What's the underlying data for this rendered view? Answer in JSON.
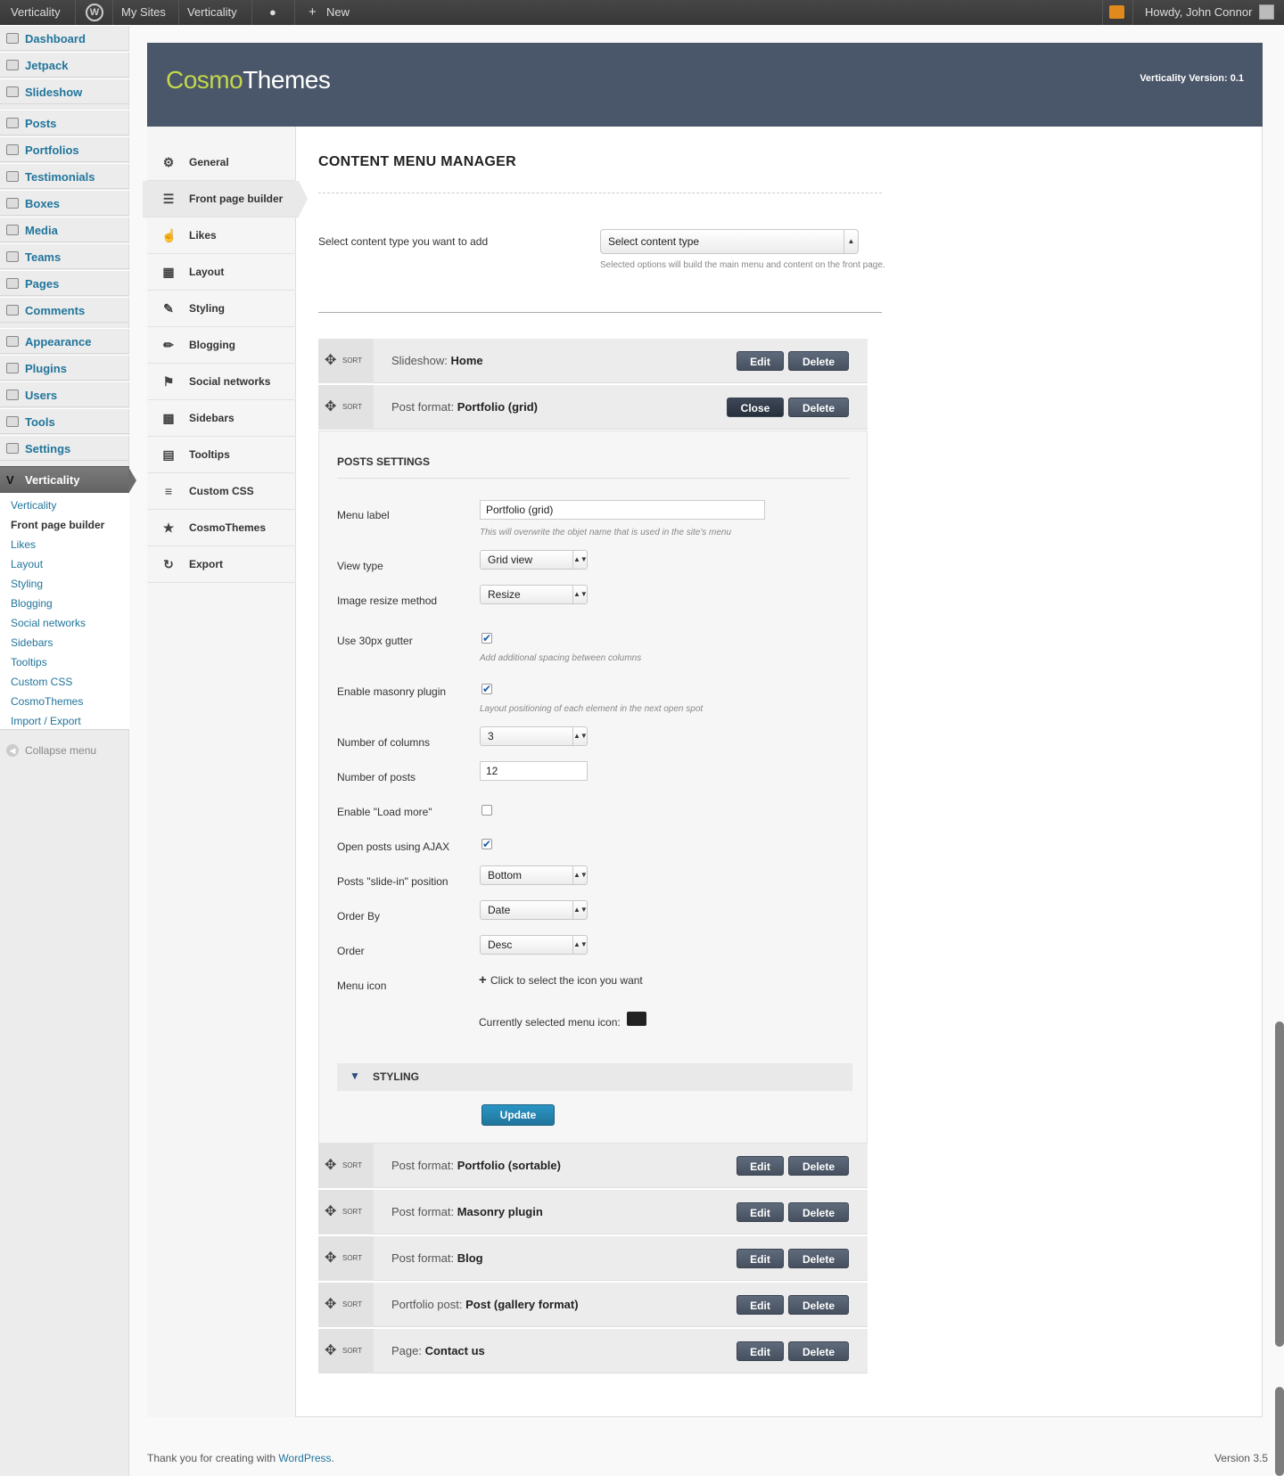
{
  "adminbar": {
    "site": "Verticality",
    "my_sites": "My Sites",
    "site2": "Verticality",
    "new": "New",
    "howdy": "Howdy, John Connor"
  },
  "menu": {
    "items": [
      {
        "label": "Dashboard",
        "icon": "dashboard-icon"
      },
      {
        "label": "Jetpack",
        "icon": "jetpack-icon"
      },
      {
        "label": "Slideshow",
        "icon": "slideshow-icon"
      },
      {
        "label": "Posts",
        "icon": "posts-icon"
      },
      {
        "label": "Portfolios",
        "icon": "portfolios-icon"
      },
      {
        "label": "Testimonials",
        "icon": "testimonials-icon"
      },
      {
        "label": "Boxes",
        "icon": "boxes-icon"
      },
      {
        "label": "Media",
        "icon": "media-icon"
      },
      {
        "label": "Teams",
        "icon": "teams-icon"
      },
      {
        "label": "Pages",
        "icon": "pages-icon"
      },
      {
        "label": "Comments",
        "icon": "comments-icon"
      },
      {
        "label": "Appearance",
        "icon": "appearance-icon"
      },
      {
        "label": "Plugins",
        "icon": "plugins-icon"
      },
      {
        "label": "Users",
        "icon": "users-icon"
      },
      {
        "label": "Tools",
        "icon": "tools-icon"
      },
      {
        "label": "Settings",
        "icon": "settings-icon"
      }
    ],
    "active": "Verticality",
    "submenu": [
      "Verticality",
      "Front page builder",
      "Likes",
      "Layout",
      "Styling",
      "Blogging",
      "Social networks",
      "Sidebars",
      "Tooltips",
      "Custom CSS",
      "CosmoThemes",
      "Import / Export"
    ],
    "collapse": "Collapse menu"
  },
  "header": {
    "logo_a": "Cosmo",
    "logo_b": "Themes",
    "version": "Verticality Version: 0.1"
  },
  "tabs": [
    "General",
    "Front page builder",
    "Likes",
    "Layout",
    "Styling",
    "Blogging",
    "Social networks",
    "Sidebars",
    "Tooltips",
    "Custom CSS",
    "CosmoThemes",
    "Export"
  ],
  "content": {
    "title": "CONTENT MENU MANAGER",
    "select_label": "Select content type you want to add",
    "select_value": "Select content type",
    "select_hint": "Selected options will build the main menu and content on the front page."
  },
  "rows": [
    {
      "prefix": "Slideshow: ",
      "name": "Home",
      "btn": "Edit"
    },
    {
      "prefix": "Post format: ",
      "name": "Portfolio (grid)",
      "btn": "Close"
    },
    {
      "prefix": "Post format: ",
      "name": "Portfolio (sortable)",
      "btn": "Edit"
    },
    {
      "prefix": "Post format: ",
      "name": "Masonry plugin",
      "btn": "Edit"
    },
    {
      "prefix": "Post format: ",
      "name": "Blog",
      "btn": "Edit"
    },
    {
      "prefix": "Portfolio post: ",
      "name": "Post (gallery format)",
      "btn": "Edit"
    },
    {
      "prefix": "Page: ",
      "name": "Contact us",
      "btn": "Edit"
    }
  ],
  "sort": "SORT",
  "delete": "Delete",
  "settings": {
    "title": "POSTS SETTINGS",
    "menu_label": "Menu label",
    "menu_label_value": "Portfolio (grid)",
    "menu_label_hint": "This will overwrite the objet name that is used in the site's menu",
    "view_type": "View type",
    "view_type_value": "Grid view",
    "resize": "Image resize method",
    "resize_value": "Resize",
    "gutter": "Use 30px gutter",
    "gutter_hint": "Add additional spacing between columns",
    "masonry": "Enable masonry plugin",
    "masonry_hint": "Layout positioning of each element in the next open spot",
    "columns": "Number of columns",
    "columns_value": "3",
    "posts": "Number of posts",
    "posts_value": "12",
    "loadmore": "Enable \"Load more\"",
    "ajax": "Open posts using AJAX",
    "slidein": "Posts \"slide-in\" position",
    "slidein_value": "Bottom",
    "orderby": "Order By",
    "orderby_value": "Date",
    "order": "Order",
    "order_value": "Desc",
    "menuicon": "Menu icon",
    "menuicon_link": "Click to select the icon you want",
    "current_icon": "Currently selected menu icon:",
    "styling": "STYLING",
    "update": "Update"
  },
  "footer": {
    "thanks": "Thank you for creating with ",
    "wp": "WordPress",
    "period": ".",
    "version": "Version 3.5"
  }
}
